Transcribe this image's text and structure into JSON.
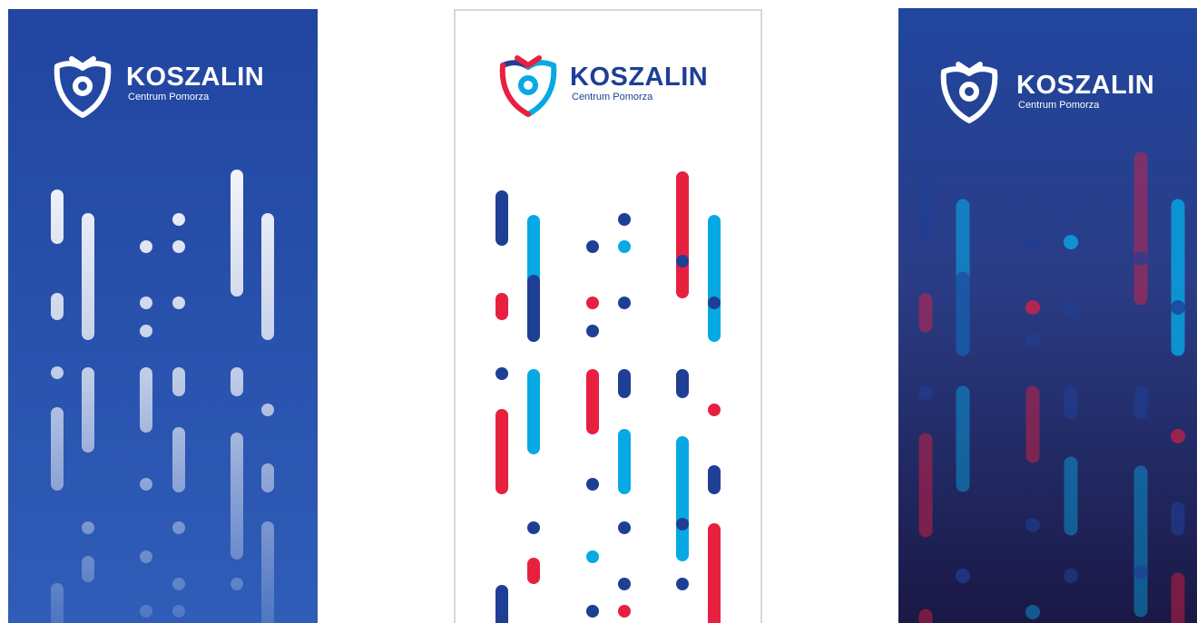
{
  "brand": {
    "name": "KOSZALIN",
    "tagline": "Centrum Pomorza"
  },
  "colors": {
    "royal_blue": "#2547a1",
    "navy": "#1f3f95",
    "cyan": "#06a9e4",
    "red": "#e8203f",
    "dark_navy": "#1b1b48",
    "white": "#ffffff",
    "border_gray": "#d7d7d7"
  },
  "banners": [
    {
      "id": "banner-blue",
      "theme": "white-on-blue"
    },
    {
      "id": "banner-white",
      "theme": "tricolor-on-white"
    },
    {
      "id": "banner-dark",
      "theme": "tricolor-on-dark-gradient"
    }
  ]
}
